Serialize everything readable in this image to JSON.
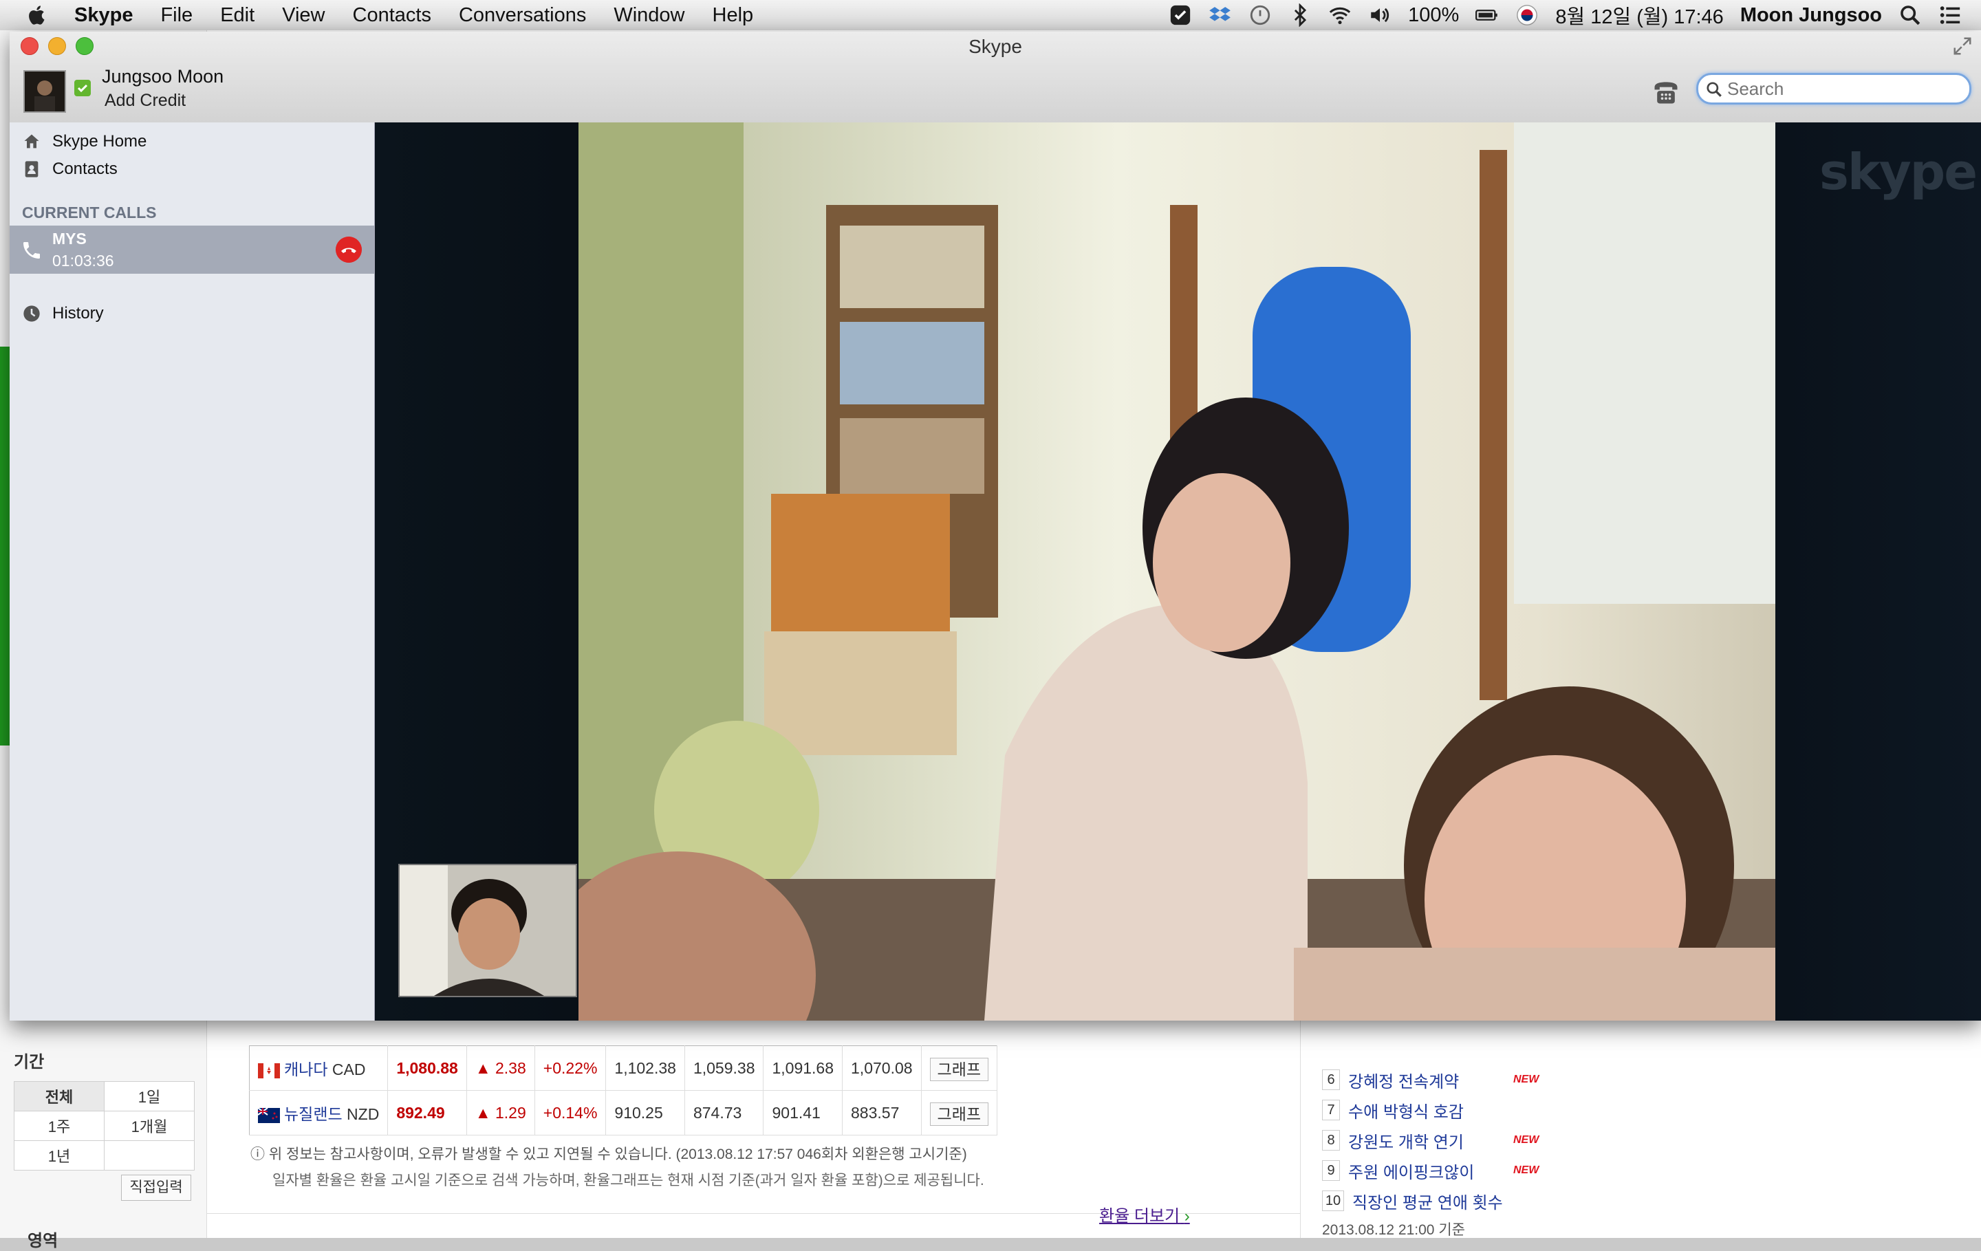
{
  "menubar": {
    "app": "Skype",
    "items": [
      "File",
      "Edit",
      "View",
      "Contacts",
      "Conversations",
      "Window",
      "Help"
    ],
    "battery": "100%",
    "datetime": "8월 12일 (월)  17:46",
    "user": "Moon Jungsoo"
  },
  "window": {
    "title": "Skype",
    "user_name": "Jungsoo Moon",
    "add_credit": "Add Credit",
    "search_placeholder": "Search"
  },
  "sidebar": {
    "home": "Skype Home",
    "contacts": "Contacts",
    "current_calls_header": "CURRENT CALLS",
    "call": {
      "name": "MYS",
      "duration": "01:03:36"
    },
    "history": "History"
  },
  "video": {
    "logo": "skype"
  },
  "background_page": {
    "period_label": "기간",
    "period_options": [
      [
        "전체",
        "1일"
      ],
      [
        "1주",
        "1개월"
      ],
      [
        "1년",
        ""
      ]
    ],
    "direct_input": "직접입력",
    "region_label": "영역",
    "rates": [
      {
        "name": "캐나다",
        "code": "CAD",
        "rate": "1,080.88",
        "change": "▲ 2.38",
        "pct": "+0.22%",
        "c1": "1,102.38",
        "c2": "1,059.38",
        "c3": "1,091.68",
        "c4": "1,070.08",
        "graph": "그래프"
      },
      {
        "name": "뉴질랜드",
        "code": "NZD",
        "rate": "892.49",
        "change": "▲ 1.29",
        "pct": "+0.14%",
        "c1": "910.25",
        "c2": "874.73",
        "c3": "901.41",
        "c4": "883.57",
        "graph": "그래프"
      }
    ],
    "note1": "위 정보는 참고사항이며, 오류가 발생할 수 있고 지연될 수 있습니다. (2013.08.12 17:57 046회차 외환은행 고시기준)",
    "note2": "일자별 환율은 환율 고시일 기준으로 검색 가능하며, 환율그래프는 현재 시점 기준(과거 일자 환율 포함)으로 제공됩니다.",
    "more_link": "환율 더보기",
    "ranking": [
      {
        "num": "6",
        "text": "강혜정 전속계약",
        "new": "NEW"
      },
      {
        "num": "7",
        "text": "수애 박형식 호감",
        "new": ""
      },
      {
        "num": "8",
        "text": "강원도 개학 연기",
        "new": "NEW"
      },
      {
        "num": "9",
        "text": "주원 에이핑크않이",
        "new": "NEW"
      },
      {
        "num": "10",
        "text": "직장인 평균 연애 횟수",
        "new": ""
      }
    ],
    "ranking_date": "2013.08.12 21:00 기준"
  }
}
